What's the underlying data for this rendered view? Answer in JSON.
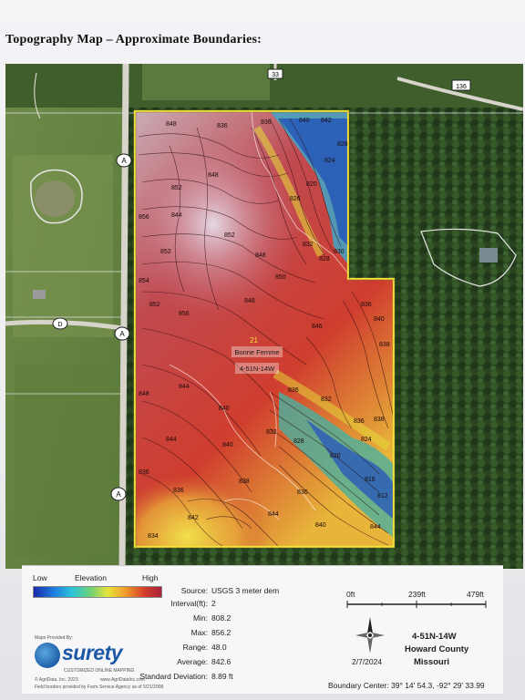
{
  "page_title": "Topography Map – Approximate Boundaries:",
  "map": {
    "road_labels": {
      "a_top": "A",
      "d": "D",
      "a_mid": "A",
      "a_bottom": "A",
      "r33": "33",
      "r136": "136"
    },
    "section_badge": "21",
    "place_name": "Bonne Femme",
    "township": "4-51N-14W",
    "contour_labels": [
      "848",
      "836",
      "852",
      "856",
      "848",
      "856",
      "852",
      "848",
      "844",
      "840",
      "836",
      "852",
      "844",
      "848",
      "844",
      "840",
      "852",
      "848",
      "830",
      "832",
      "828",
      "824",
      "856",
      "836",
      "840",
      "844",
      "838",
      "836",
      "820",
      "824",
      "828",
      "832",
      "836",
      "828",
      "838",
      "840",
      "842",
      "842",
      "846",
      "852",
      "848",
      "844",
      "828",
      "816",
      "812",
      "820",
      "836",
      "832",
      "838",
      "846",
      "844"
    ]
  },
  "legend": {
    "low_label": "Low",
    "elevation_label": "Elevation",
    "high_label": "High",
    "source_key": "Source:",
    "source_value": "USGS 3 meter dem",
    "interval_key": "Interval(ft):",
    "interval_value": "2",
    "min_key": "Min:",
    "min_value": "808.2",
    "max_key": "Max:",
    "max_value": "856.2",
    "range_key": "Range:",
    "range_value": "48.0",
    "average_key": "Average:",
    "average_value": "842.6",
    "std_key": "Standard Deviation:",
    "std_value": "8.89 ft",
    "scale": [
      "0ft",
      "239ft",
      "479ft"
    ],
    "date": "2/7/2024",
    "location_township": "4-51N-14W",
    "location_county": "Howard County",
    "location_state": "Missouri",
    "boundary_center": "Boundary Center: 39° 14' 54.3, -92° 29' 33.99",
    "maps_provided_by": "Maps Provided By:",
    "logo_text": "surety",
    "logo_tagline": "CUSTOMIZED ONLINE MAPPING",
    "copyright": "© AgriData, Inc. 2023",
    "website": "www.AgriDataInc.com",
    "field_borders_note": "Field borders provided by Farm Service Agency as of 5/21/2008."
  },
  "colors": {
    "boundary": "#f4e23a",
    "high": "#b8203a",
    "mid": "#e8b43a",
    "low": "#1a2aa8"
  }
}
